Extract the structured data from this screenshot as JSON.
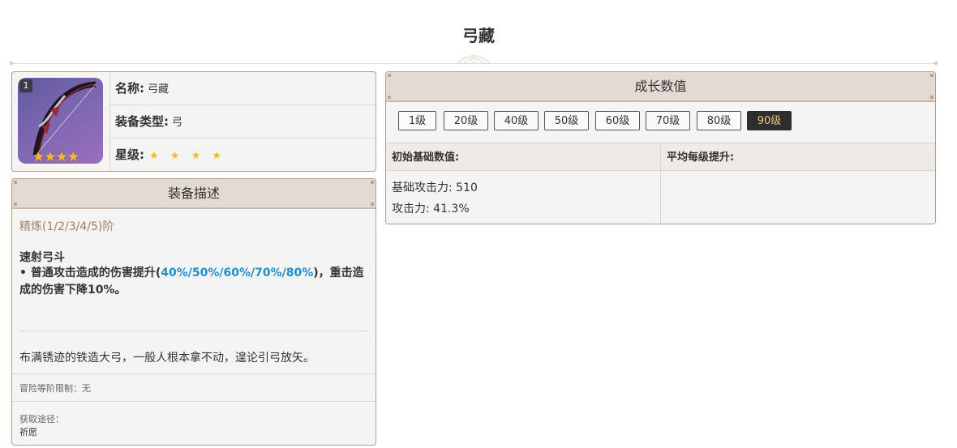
{
  "page": {
    "title": "弓藏"
  },
  "weapon_info": {
    "refine_badge": "1",
    "name_label": "名称:",
    "name_value": "弓藏",
    "type_label": "装备类型:",
    "type_value": "弓",
    "rarity_label": "星级:",
    "rarity_stars": "★ ★ ★ ★",
    "image_stars": "★★★★",
    "rarity": 4
  },
  "description": {
    "header": "装备描述",
    "refine_label": "精炼(1/2/3/4/5)阶",
    "skill_name": "速射弓斗",
    "skill_prefix": "• 普通攻击造成的伤害提升(",
    "skill_values": "40%/50%/60%/70%/80%",
    "skill_suffix": ")，重击造成的伤害下降10%。",
    "flavor": "布满锈迹的铁造大弓，一般人根本拿不动，遑论引弓放矢。",
    "rank_limit": "冒险等阶限制：无",
    "source_label": "获取途径：",
    "source_value": "祈愿"
  },
  "growth": {
    "header": "成长数值",
    "levels": [
      "1级",
      "20级",
      "40级",
      "50级",
      "60级",
      "70级",
      "80级",
      "90级"
    ],
    "active_level": "90级",
    "base_header": "初始基础数值:",
    "avg_header": "平均每级提升:",
    "stats": [
      "基础攻击力: 510",
      "攻击力: 41.3%"
    ]
  },
  "colors": {
    "border": "#b79c8a",
    "header_bg": "#e3dbd3",
    "highlight": "#1e8fc9",
    "refine_text": "#a08060",
    "star": "#f5b82d",
    "active_btn_bg": "#2d2d2d",
    "active_btn_text": "#e8c77a"
  }
}
